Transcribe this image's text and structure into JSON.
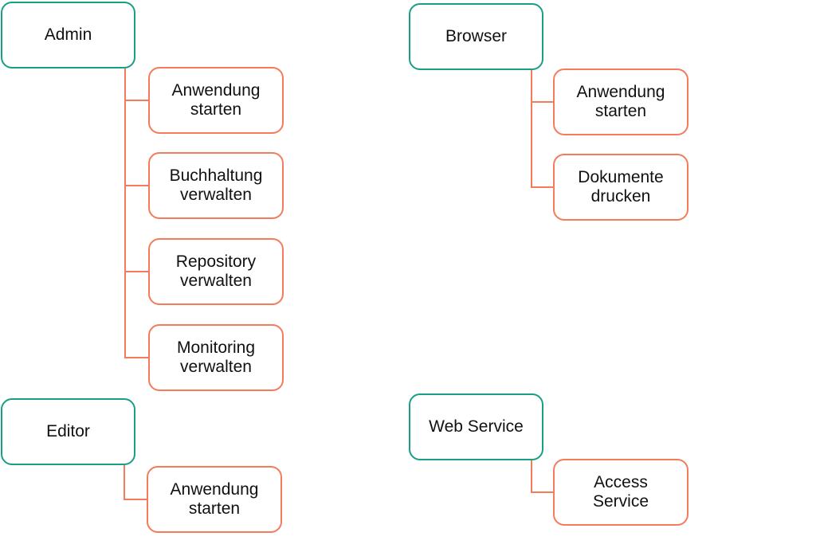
{
  "colors": {
    "role_border": "#17a085",
    "action_border": "#f47c5c",
    "connector": "#f47c5c"
  },
  "groups": [
    {
      "role": "Admin",
      "actions": [
        "Anwendung\nstarten",
        "Buchhaltung\nverwalten",
        "Repository\nverwalten",
        "Monitoring\nverwalten"
      ]
    },
    {
      "role": "Editor",
      "actions": [
        "Anwendung\nstarten"
      ]
    },
    {
      "role": "Browser",
      "actions": [
        "Anwendung\nstarten",
        "Dokumente\ndrucken"
      ]
    },
    {
      "role": "Web Service",
      "actions": [
        "Access\nService"
      ]
    }
  ]
}
